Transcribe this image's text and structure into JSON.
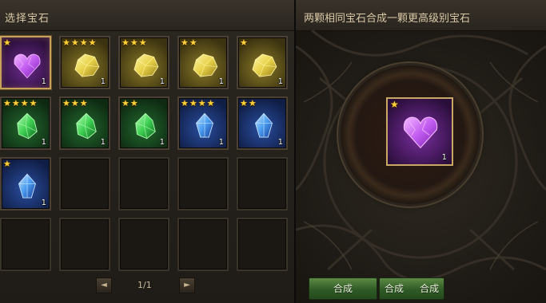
{
  "left": {
    "title": "选择宝石"
  },
  "right": {
    "title": "两颗相同宝石合成一颗更高级别宝石"
  },
  "gems": [
    {
      "color": "purple",
      "stars": 1,
      "count": "1",
      "selected": true
    },
    {
      "color": "yellow",
      "stars": 4,
      "count": "1"
    },
    {
      "color": "yellow",
      "stars": 3,
      "count": "1"
    },
    {
      "color": "yellow",
      "stars": 2,
      "count": "1"
    },
    {
      "color": "yellow",
      "stars": 1,
      "count": "1"
    },
    {
      "color": "green",
      "stars": 4,
      "count": "1"
    },
    {
      "color": "green",
      "stars": 3,
      "count": "1"
    },
    {
      "color": "green",
      "stars": 2,
      "count": "1"
    },
    {
      "color": "blue",
      "stars": 4,
      "count": "1"
    },
    {
      "color": "blue",
      "stars": 2,
      "count": "1"
    },
    {
      "color": "blue",
      "stars": 1,
      "count": "1"
    },
    {
      "color": null
    },
    {
      "color": null
    },
    {
      "color": null
    },
    {
      "color": null
    },
    {
      "color": null
    },
    {
      "color": null
    },
    {
      "color": null
    },
    {
      "color": null
    },
    {
      "color": null
    }
  ],
  "pager": {
    "prev_icon": "◄",
    "next_icon": "►",
    "indicator": "1/1"
  },
  "result": {
    "color": "purple",
    "stars": 1,
    "count": "1"
  },
  "buttons": {
    "compose": "合成",
    "compose_all_left": "合成",
    "compose_all_right": "合成"
  },
  "colors": {
    "purple": [
      "#f3b6ff",
      "#c25cf0",
      "#7a1fb0"
    ],
    "yellow": [
      "#fff6a8",
      "#e8d24a",
      "#9a8218"
    ],
    "green": [
      "#b8ffb8",
      "#3ecf52",
      "#0f6a1e"
    ],
    "blue": [
      "#c8e6ff",
      "#4a9cf0",
      "#173f9c"
    ],
    "star": "#ffd23a",
    "frame_gold": "#c9a25a"
  }
}
